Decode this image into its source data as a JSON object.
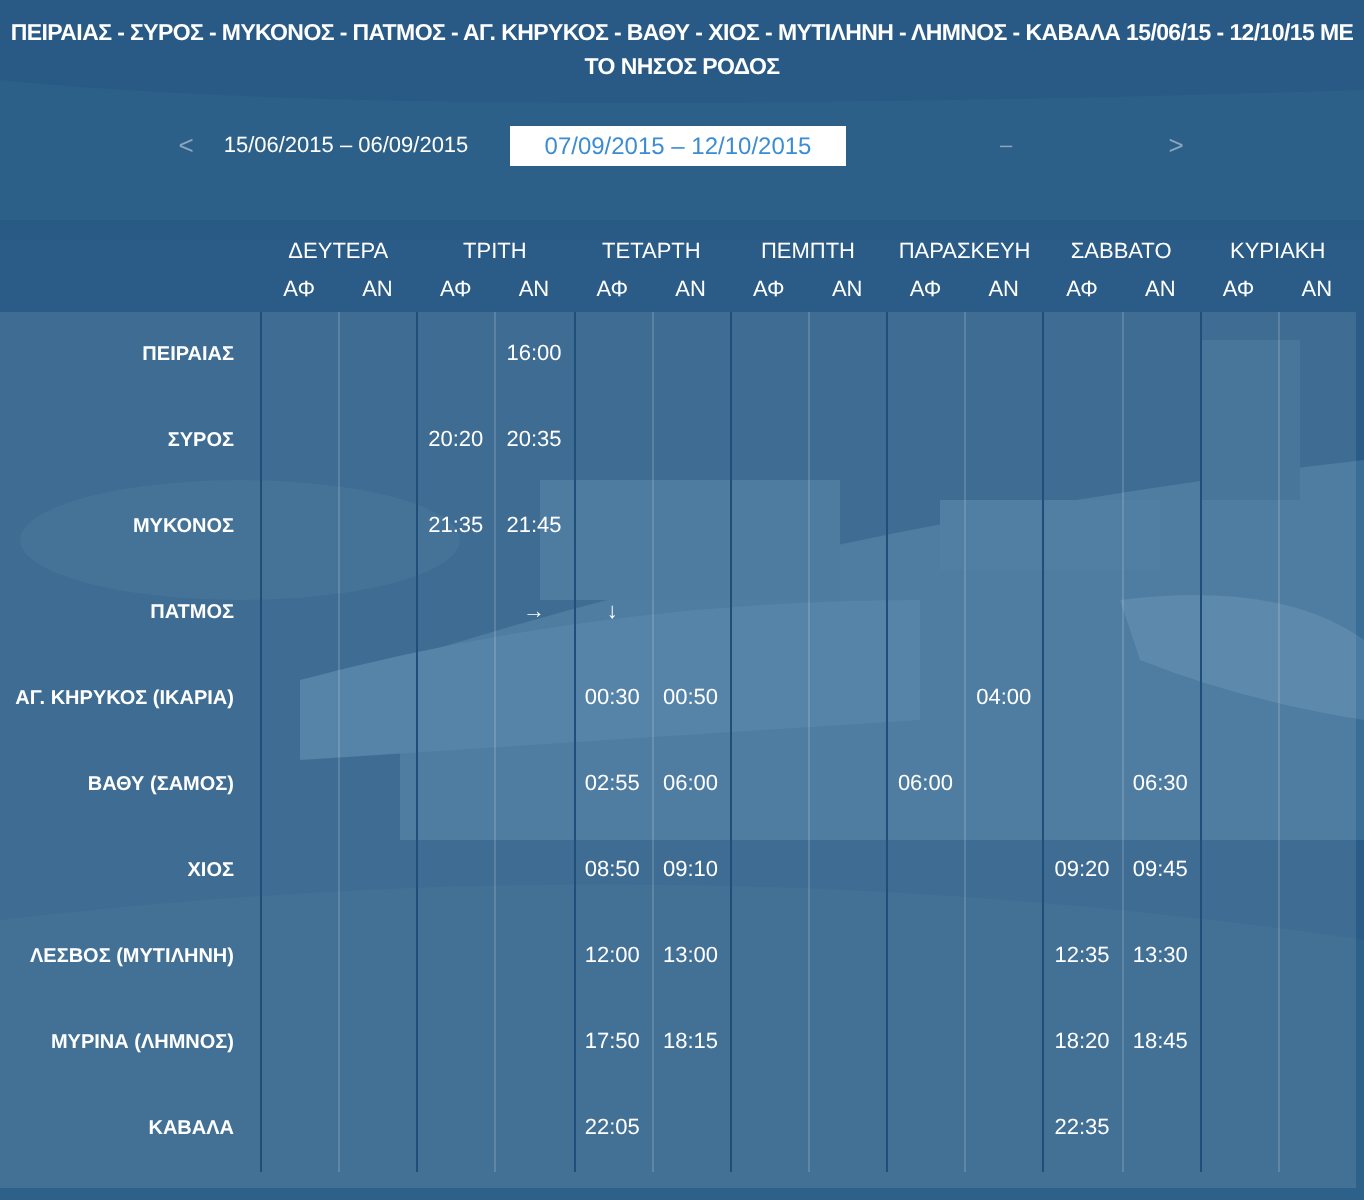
{
  "title": "ΠΕΙΡΑΙΑΣ - ΣΥΡΟΣ - ΜΥΚΟΝΟΣ - ΠΑΤΜΟΣ - ΑΓ. ΚΗΡΥΚΟΣ - ΒΑΘΥ - ΧΙΟΣ - ΜΥΤΙΛΗΝΗ - ΛΗΜΝΟΣ - ΚΑΒΑΛΑ 15/06/15 - 12/10/15 ΜΕ ΤΟ ΝΗΣΟΣ ΡΟΔΟΣ",
  "period_nav": {
    "prev": "<",
    "next": ">",
    "periods": [
      {
        "label": "15/06/2015 – 06/09/2015",
        "selected": false,
        "disabled": false
      },
      {
        "label": "07/09/2015 – 12/10/2015",
        "selected": true,
        "disabled": false
      },
      {
        "label": "–",
        "selected": false,
        "disabled": true
      }
    ]
  },
  "schedule": {
    "days": [
      {
        "label": "ΔΕΥΤΕΡΑ",
        "sub": [
          "ΑΦ",
          "ΑΝ"
        ]
      },
      {
        "label": "ΤΡΙΤΗ",
        "sub": [
          "ΑΦ",
          "ΑΝ"
        ]
      },
      {
        "label": "ΤΕΤΑΡΤΗ",
        "sub": [
          "ΑΦ",
          "ΑΝ"
        ]
      },
      {
        "label": "ΠΕΜΠΤΗ",
        "sub": [
          "ΑΦ",
          "ΑΝ"
        ]
      },
      {
        "label": "ΠΑΡΑΣΚΕΥΗ",
        "sub": [
          "ΑΦ",
          "ΑΝ"
        ]
      },
      {
        "label": "ΣΑΒΒΑΤΟ",
        "sub": [
          "ΑΦ",
          "ΑΝ"
        ]
      },
      {
        "label": "ΚΥΡΙΑΚΗ",
        "sub": [
          "ΑΦ",
          "ΑΝ"
        ]
      }
    ],
    "rows": [
      {
        "port": "ΠΕΙΡΑΙΑΣ",
        "cells": [
          null,
          null,
          null,
          "16:00",
          null,
          null,
          null,
          null,
          null,
          null,
          null,
          null,
          null,
          null
        ]
      },
      {
        "port": "ΣΥΡΟΣ",
        "cells": [
          null,
          null,
          "20:20",
          "20:35",
          null,
          null,
          null,
          null,
          null,
          null,
          null,
          null,
          null,
          null
        ]
      },
      {
        "port": "ΜΥΚΟΝΟΣ",
        "cells": [
          null,
          null,
          "21:35",
          "21:45",
          null,
          null,
          null,
          null,
          null,
          null,
          null,
          null,
          null,
          null
        ]
      },
      {
        "port": "ΠΑΤΜΟΣ",
        "cells": [
          null,
          null,
          null,
          "→",
          "↓",
          null,
          null,
          null,
          null,
          null,
          null,
          null,
          null,
          null
        ]
      },
      {
        "port": "ΑΓ. ΚΗΡΥΚΟΣ (ΙΚΑΡΙΑ)",
        "cells": [
          null,
          null,
          null,
          null,
          "00:30",
          "00:50",
          null,
          null,
          null,
          "04:00",
          null,
          null,
          null,
          null
        ]
      },
      {
        "port": "ΒΑΘΥ (ΣΑΜΟΣ)",
        "cells": [
          null,
          null,
          null,
          null,
          "02:55",
          "06:00",
          null,
          null,
          "06:00",
          null,
          null,
          "06:30",
          null,
          null
        ]
      },
      {
        "port": "ΧΙΟΣ",
        "cells": [
          null,
          null,
          null,
          null,
          "08:50",
          "09:10",
          null,
          null,
          null,
          null,
          "09:20",
          "09:45",
          null,
          null
        ]
      },
      {
        "port": "ΛΕΣΒΟΣ (ΜΥΤΙΛΗΝΗ)",
        "cells": [
          null,
          null,
          null,
          null,
          "12:00",
          "13:00",
          null,
          null,
          null,
          null,
          "12:35",
          "13:30",
          null,
          null
        ]
      },
      {
        "port": "ΜΥΡΙΝΑ (ΛΗΜΝΟΣ)",
        "cells": [
          null,
          null,
          null,
          null,
          "17:50",
          "18:15",
          null,
          null,
          null,
          null,
          "18:20",
          "18:45",
          null,
          null
        ]
      },
      {
        "port": "ΚΑΒΑΛΑ",
        "cells": [
          null,
          null,
          null,
          null,
          "22:05",
          null,
          null,
          null,
          null,
          null,
          "22:35",
          null,
          null,
          null
        ]
      }
    ]
  }
}
